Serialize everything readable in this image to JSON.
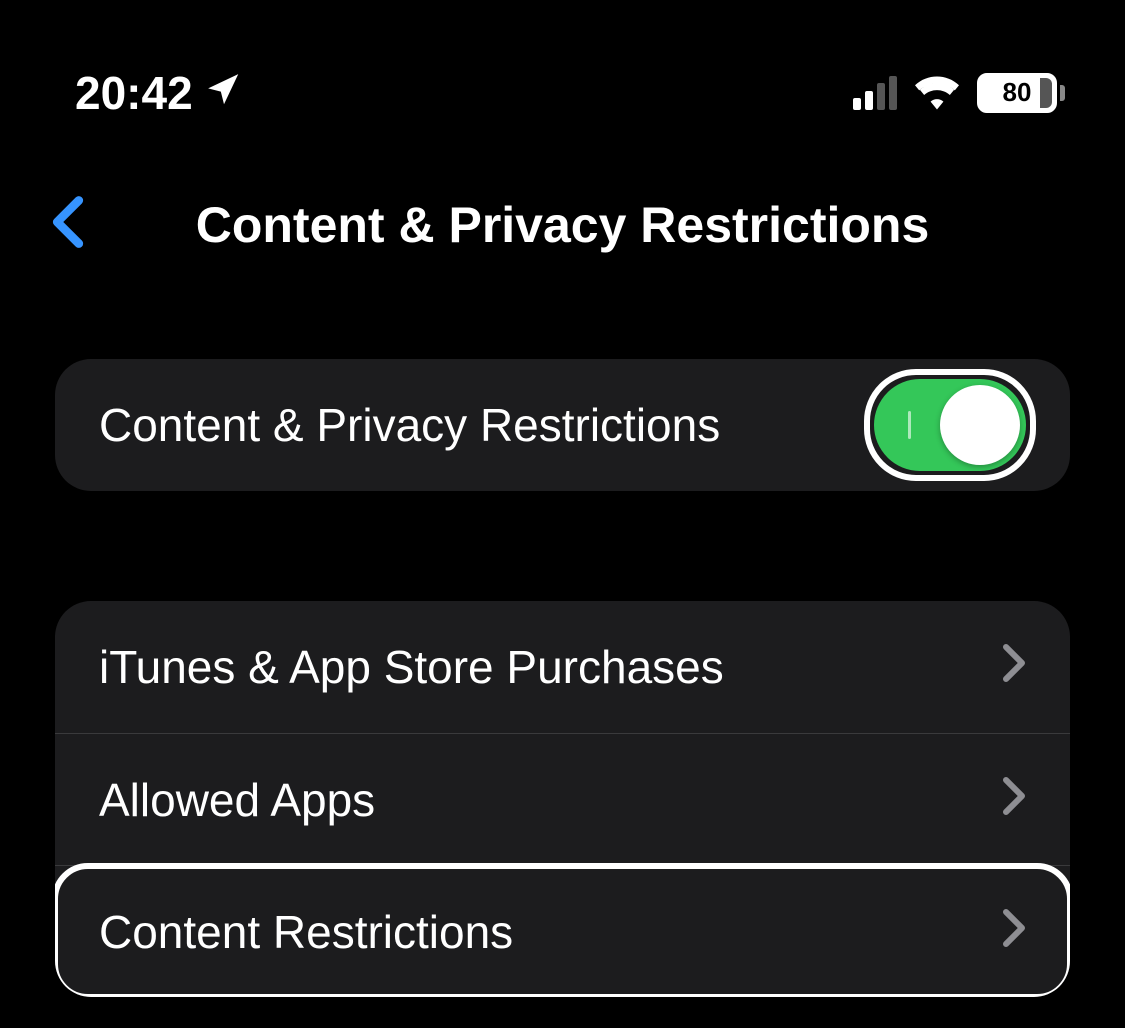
{
  "status_bar": {
    "time": "20:42",
    "battery_percent": "80"
  },
  "header": {
    "title": "Content & Privacy Restrictions"
  },
  "toggle_row": {
    "label": "Content & Privacy Restrictions",
    "on": true
  },
  "menu": {
    "items": [
      {
        "label": "iTunes & App Store Purchases"
      },
      {
        "label": "Allowed Apps"
      },
      {
        "label": "Content Restrictions"
      }
    ]
  }
}
